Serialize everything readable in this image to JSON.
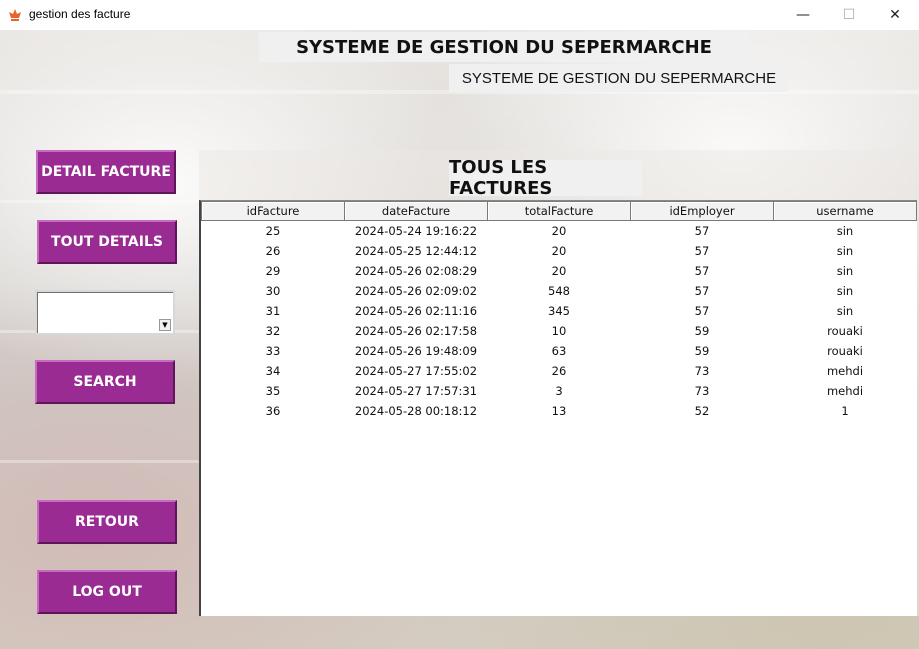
{
  "window": {
    "title": "gestion des facture",
    "minimize": "—",
    "maximize": "☐",
    "close": "✕"
  },
  "header": {
    "title": "SYSTEME DE GESTION DU SEPERMARCHE",
    "subtitle": "SYSTEME DE GESTION DU SEPERMARCHE"
  },
  "sidebar": {
    "detail_facture": "DETAIL FACTURE",
    "tout_details": "TOUT DETAILS",
    "search_value": "",
    "search": "SEARCH",
    "retour": "RETOUR",
    "logout": "LOG OUT"
  },
  "panel": {
    "title": "TOUS LES FACTURES"
  },
  "table": {
    "columns": [
      "idFacture",
      "dateFacture",
      "totalFacture",
      "idEmployer",
      "username"
    ],
    "rows": [
      [
        "25",
        "2024-05-24 19:16:22",
        "20",
        "57",
        "sin"
      ],
      [
        "26",
        "2024-05-25 12:44:12",
        "20",
        "57",
        "sin"
      ],
      [
        "29",
        "2024-05-26 02:08:29",
        "20",
        "57",
        "sin"
      ],
      [
        "30",
        "2024-05-26 02:09:02",
        "548",
        "57",
        "sin"
      ],
      [
        "31",
        "2024-05-26 02:11:16",
        "345",
        "57",
        "sin"
      ],
      [
        "32",
        "2024-05-26 02:17:58",
        "10",
        "59",
        "rouaki"
      ],
      [
        "33",
        "2024-05-26 19:48:09",
        "63",
        "59",
        "rouaki"
      ],
      [
        "34",
        "2024-05-27 17:55:02",
        "26",
        "73",
        "mehdi"
      ],
      [
        "35",
        "2024-05-27 17:57:31",
        "3",
        "73",
        "mehdi"
      ],
      [
        "36",
        "2024-05-28 00:18:12",
        "13",
        "52",
        "1"
      ]
    ]
  },
  "colors": {
    "button": "#9a2b93",
    "button_text": "#ffffff",
    "app_icon": "#e8622c"
  }
}
